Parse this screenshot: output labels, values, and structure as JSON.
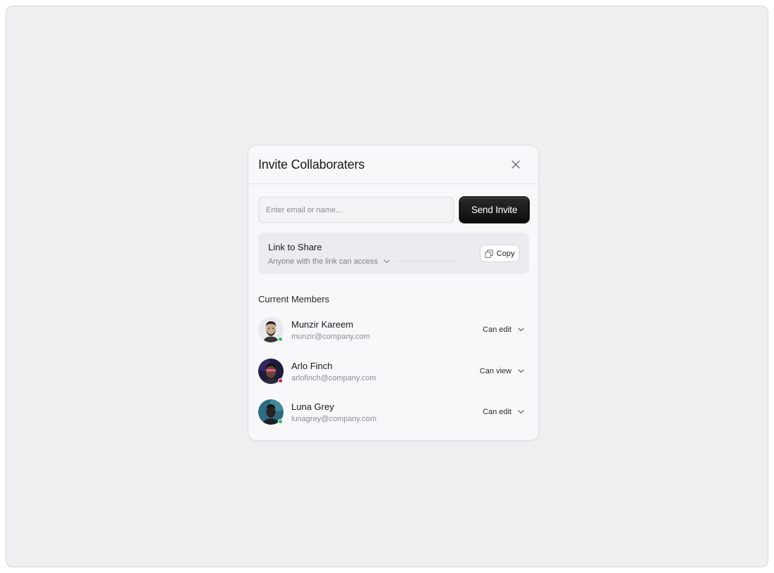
{
  "dialog": {
    "title": "Invite Collaboraters",
    "close_icon": "close-icon"
  },
  "invite": {
    "placeholder": "Enter email or name...",
    "value": "",
    "send_label": "Send Invite"
  },
  "share": {
    "title": "Link to Share",
    "access": "Anyone with the link can access",
    "copy_label": "Copy",
    "copy_icon": "copy-icon"
  },
  "members": {
    "heading": "Current Members",
    "items": [
      {
        "name": "Munzir Kareem",
        "email": "munzir@company.com",
        "permission": "Can edit",
        "status": "online",
        "status_color": "#22c55e"
      },
      {
        "name": "Arlo Finch",
        "email": "arlofinch@company.com",
        "permission": "Can view",
        "status": "busy",
        "status_color": "#e11d48"
      },
      {
        "name": "Luna Grey",
        "email": "lunagrey@company.com",
        "permission": "Can edit",
        "status": "online",
        "status_color": "#22c55e"
      }
    ]
  },
  "colors": {
    "background": "#efeef1",
    "dialog": "#f8f7fa",
    "primary_button": "#111112"
  }
}
